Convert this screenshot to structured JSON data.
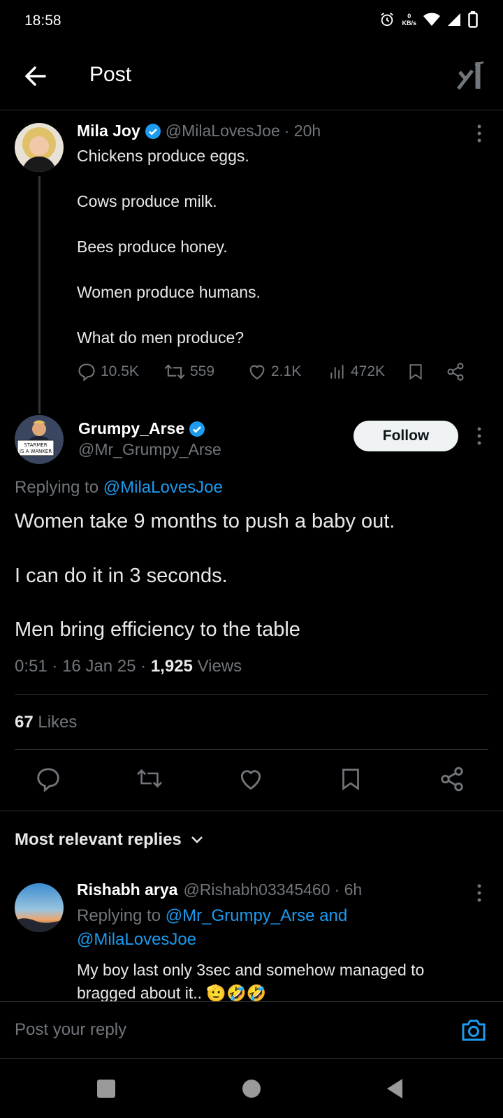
{
  "status_bar": {
    "time": "18:58",
    "network_speed_value": "0",
    "network_speed_unit": "KB/s"
  },
  "header": {
    "title": "Post",
    "back_icon": "arrow-left-icon",
    "grok_icon": "grok-icon"
  },
  "original_post": {
    "author_name": "Mila Joy",
    "author_handle": "@MilaLovesJoe",
    "time_ago": "· 20h",
    "text": "Chickens produce eggs.\n\nCows produce milk.\n\nBees produce honey.\n\nWomen produce humans.\n\nWhat do men produce?",
    "replies": "10.5K",
    "reposts": "559",
    "likes": "2.1K",
    "views": "472K"
  },
  "main_post": {
    "author_name": "Grumpy_Arse",
    "author_handle": "@Mr_Grumpy_Arse",
    "follow_label": "Follow",
    "replying_prefix": "Replying to ",
    "replying_handle": "@MilaLovesJoe",
    "avatar_sign_line1": "STARMER",
    "avatar_sign_line2": "IS A WANKER",
    "text": "Women take 9 months to push a baby out.\n\nI can do it in 3 seconds.\n\nMen bring efficiency to the table",
    "time": "0:51",
    "date": "16 Jan 25",
    "views_count": "1,925",
    "views_label": "Views",
    "likes_count": "67",
    "likes_label": "Likes"
  },
  "replies_section": {
    "sort_label": "Most relevant replies"
  },
  "reply": {
    "author_name": "Rishabh arya",
    "author_handle": "@Rishabh03345460",
    "time_ago": "· 6h",
    "replying_prefix": "Replying to ",
    "replying_handle_1": "@Mr_Grumpy_Arse",
    "replying_and": "and",
    "replying_handle_2": "@MilaLovesJoe",
    "text": "My boy last only 3sec and somehow managed to bragged about it.. 🫡🤣🤣"
  },
  "composer": {
    "placeholder": "Post your reply"
  },
  "colors": {
    "background": "#000000",
    "link": "#1d9bf0",
    "secondary_text": "#71767b",
    "divider": "#2f3336"
  }
}
